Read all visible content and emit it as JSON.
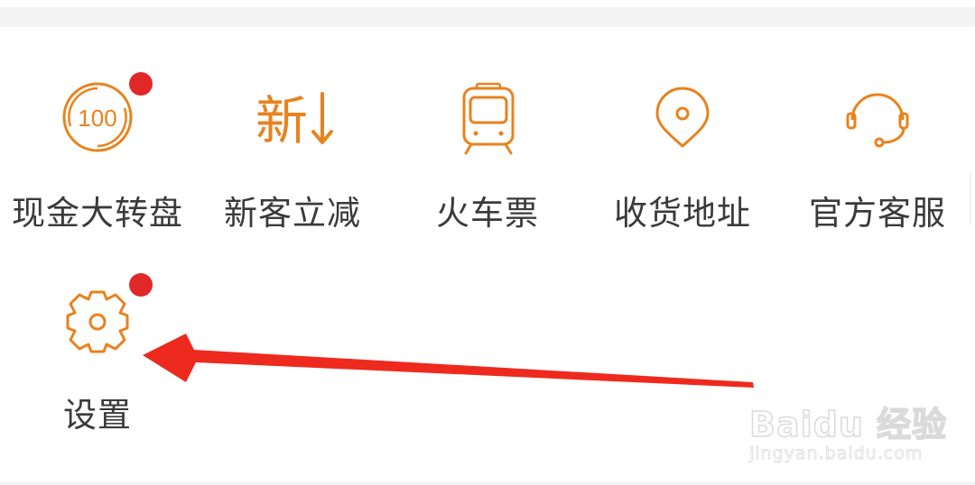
{
  "theme": {
    "accent": "#e8821e",
    "badge": "#e02828",
    "label_color": "#3a3a3a",
    "annotation_arrow": "#ee2a1f"
  },
  "services": {
    "items": [
      {
        "label": "现金大转盘",
        "icon": "prize-wheel-icon",
        "has_badge": true,
        "icon_text": "100"
      },
      {
        "label": "新客立减",
        "icon": "new-customer-icon",
        "has_badge": false,
        "icon_text": "新"
      },
      {
        "label": "火车票",
        "icon": "train-icon",
        "has_badge": false
      },
      {
        "label": "收货地址",
        "icon": "location-pin-icon",
        "has_badge": false
      },
      {
        "label": "官方客服",
        "icon": "headset-icon",
        "has_badge": false
      },
      {
        "label": "设置",
        "icon": "gear-icon",
        "has_badge": true
      }
    ]
  },
  "watermark": {
    "brand": "Baidu 经验",
    "url": "jingyan.baidu.com"
  }
}
